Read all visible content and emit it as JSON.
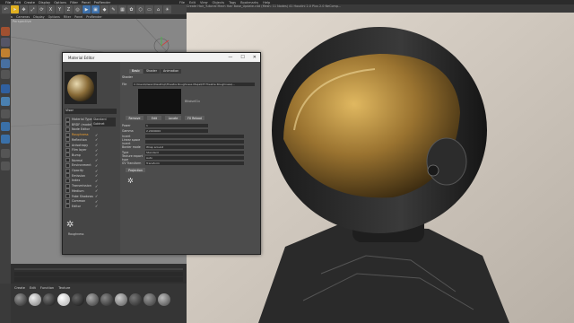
{
  "menu": {
    "items": [
      "File",
      "Edit",
      "Create",
      "Display",
      "Options",
      "Filter",
      "Panel",
      "ProRender"
    ]
  },
  "render_menu": {
    "items": [
      "File",
      "Edit",
      "View",
      "Objects",
      "Tags",
      "Bookmarks",
      "Help"
    ]
  },
  "title_center": "Create Hair_Tutorial Mech Hair Base_Update.c4d (Mesh: 11 Nodes) 41 Houdini 2.0 Plus 2.0 NeComp...",
  "viewport": {
    "label": "Perspective"
  },
  "toolbar": {
    "icons": [
      "undo-icon",
      "cursor-icon",
      "move-icon",
      "scale-icon",
      "rotate-icon",
      "x-axis",
      "y-axis",
      "z-axis",
      "world-icon",
      "render-icon",
      "render-view-icon"
    ]
  },
  "x_label": "X",
  "y_label": "Y",
  "z_label": "Z",
  "material_editor": {
    "title": "Material Editor",
    "name": "Visor",
    "channels": [
      {
        "label": "Material Type",
        "value": "Standard"
      },
      {
        "label": "BRDF (model)",
        "value": "Goldnet"
      },
      {
        "label": "Node Editor",
        "value": ""
      },
      {
        "label": "Roughness",
        "value": "",
        "check": true,
        "highlight": true
      },
      {
        "label": "Reflection",
        "value": "",
        "check": true
      },
      {
        "label": "Anisotropy",
        "value": "",
        "check": true
      },
      {
        "label": "Film layer",
        "value": "",
        "check": true
      },
      {
        "label": "Bump",
        "value": "",
        "check": true
      },
      {
        "label": "Normal",
        "value": "",
        "check": true
      },
      {
        "label": "Environment",
        "value": "",
        "check": true
      },
      {
        "label": "Opacity",
        "value": "",
        "check": true
      },
      {
        "label": "Emission",
        "value": "",
        "check": true
      },
      {
        "label": "Index",
        "value": "",
        "check": true
      },
      {
        "label": "Transmission",
        "value": "",
        "check": true
      },
      {
        "label": "Medium",
        "value": "",
        "check": true
      },
      {
        "label": "Fake Shadows",
        "value": "",
        "check": true
      },
      {
        "label": "Common",
        "value": "",
        "check": true
      },
      {
        "label": "Editor",
        "value": "",
        "check": true
      }
    ],
    "tabs": [
      "Basic",
      "Shader",
      "Animation"
    ],
    "shader_label": "Shader",
    "path": "C:\\Users\\Owen\\Desktop\\Theatre Roughness Maps\\DF-Theatre Roughness\\...",
    "shader_name": "BNoise01x",
    "buttons": [
      "Remove",
      "Edit",
      "Locate",
      "FX Reload"
    ],
    "props": [
      {
        "label": "Power",
        "value": "1"
      },
      {
        "label": "Gamma",
        "value": "2.2000000"
      },
      {
        "label": "Invert",
        "value": ""
      },
      {
        "label": "Linear space invert",
        "value": ""
      },
      {
        "label": "Border mode",
        "value": "Wrap around"
      },
      {
        "label": "Type",
        "value": "Standard"
      },
      {
        "label": "Texture export type",
        "value": "Auto"
      },
      {
        "label": "UV Transform",
        "value": "Transform"
      }
    ],
    "projection": "Projection",
    "node_label": "Roughness"
  },
  "colors": {
    "accent": "#f0a030",
    "visor": "#b48a38"
  }
}
